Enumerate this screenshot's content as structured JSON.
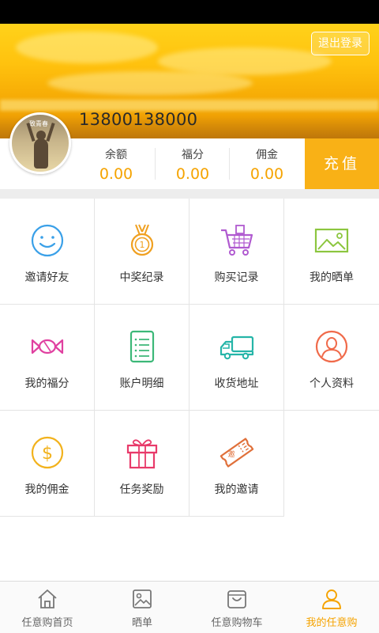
{
  "header": {
    "logout_label": "退出登录",
    "phone": "13800138000",
    "avatar_caption": "致青春"
  },
  "stats": [
    {
      "label": "余额",
      "value": "0.00"
    },
    {
      "label": "福分",
      "value": "0.00"
    },
    {
      "label": "佣金",
      "value": "0.00"
    }
  ],
  "recharge_label": "充值",
  "menu": [
    {
      "label": "邀请好友",
      "icon": "smiley-icon",
      "color": "#3aa0e8"
    },
    {
      "label": "中奖纪录",
      "icon": "medal-icon",
      "color": "#f0a020"
    },
    {
      "label": "购买记录",
      "icon": "shopping-cart-icon",
      "color": "#b05ad0"
    },
    {
      "label": "我的晒单",
      "icon": "picture-icon",
      "color": "#8cc63f"
    },
    {
      "label": "我的福分",
      "icon": "candy-icon",
      "color": "#e040a0"
    },
    {
      "label": "账户明细",
      "icon": "list-document-icon",
      "color": "#3cb878"
    },
    {
      "label": "收货地址",
      "icon": "truck-icon",
      "color": "#25b5a8"
    },
    {
      "label": "个人资料",
      "icon": "person-icon",
      "color": "#f06a4a"
    },
    {
      "label": "我的佣金",
      "icon": "dollar-coin-icon",
      "color": "#f2b21c"
    },
    {
      "label": "任务奖励",
      "icon": "gift-icon",
      "color": "#e83a6a"
    },
    {
      "label": "我的邀请",
      "icon": "invite-ticket-icon",
      "color": "#e0703a",
      "badge": "邀"
    }
  ],
  "tabs": [
    {
      "label": "任意购首页",
      "icon": "home-icon",
      "active": false
    },
    {
      "label": "晒单",
      "icon": "photo-icon",
      "active": false
    },
    {
      "label": "任意购物车",
      "icon": "cart-bag-icon",
      "active": false
    },
    {
      "label": "我的任意购",
      "icon": "user-icon",
      "active": true
    }
  ],
  "colors": {
    "accent": "#f9b116",
    "value_text": "#f5a300",
    "inactive_tab": "#777777"
  }
}
